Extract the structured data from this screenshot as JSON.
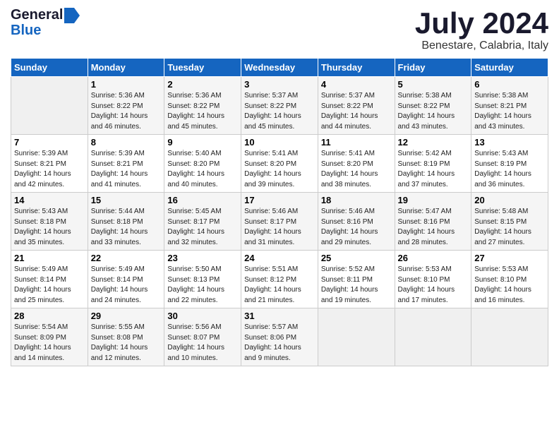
{
  "logo": {
    "line1": "General",
    "line2": "Blue"
  },
  "title": "July 2024",
  "location": "Benestare, Calabria, Italy",
  "weekdays": [
    "Sunday",
    "Monday",
    "Tuesday",
    "Wednesday",
    "Thursday",
    "Friday",
    "Saturday"
  ],
  "weeks": [
    [
      {
        "day": "",
        "info": ""
      },
      {
        "day": "1",
        "info": "Sunrise: 5:36 AM\nSunset: 8:22 PM\nDaylight: 14 hours\nand 46 minutes."
      },
      {
        "day": "2",
        "info": "Sunrise: 5:36 AM\nSunset: 8:22 PM\nDaylight: 14 hours\nand 45 minutes."
      },
      {
        "day": "3",
        "info": "Sunrise: 5:37 AM\nSunset: 8:22 PM\nDaylight: 14 hours\nand 45 minutes."
      },
      {
        "day": "4",
        "info": "Sunrise: 5:37 AM\nSunset: 8:22 PM\nDaylight: 14 hours\nand 44 minutes."
      },
      {
        "day": "5",
        "info": "Sunrise: 5:38 AM\nSunset: 8:22 PM\nDaylight: 14 hours\nand 43 minutes."
      },
      {
        "day": "6",
        "info": "Sunrise: 5:38 AM\nSunset: 8:21 PM\nDaylight: 14 hours\nand 43 minutes."
      }
    ],
    [
      {
        "day": "7",
        "info": "Sunrise: 5:39 AM\nSunset: 8:21 PM\nDaylight: 14 hours\nand 42 minutes."
      },
      {
        "day": "8",
        "info": "Sunrise: 5:39 AM\nSunset: 8:21 PM\nDaylight: 14 hours\nand 41 minutes."
      },
      {
        "day": "9",
        "info": "Sunrise: 5:40 AM\nSunset: 8:20 PM\nDaylight: 14 hours\nand 40 minutes."
      },
      {
        "day": "10",
        "info": "Sunrise: 5:41 AM\nSunset: 8:20 PM\nDaylight: 14 hours\nand 39 minutes."
      },
      {
        "day": "11",
        "info": "Sunrise: 5:41 AM\nSunset: 8:20 PM\nDaylight: 14 hours\nand 38 minutes."
      },
      {
        "day": "12",
        "info": "Sunrise: 5:42 AM\nSunset: 8:19 PM\nDaylight: 14 hours\nand 37 minutes."
      },
      {
        "day": "13",
        "info": "Sunrise: 5:43 AM\nSunset: 8:19 PM\nDaylight: 14 hours\nand 36 minutes."
      }
    ],
    [
      {
        "day": "14",
        "info": "Sunrise: 5:43 AM\nSunset: 8:18 PM\nDaylight: 14 hours\nand 35 minutes."
      },
      {
        "day": "15",
        "info": "Sunrise: 5:44 AM\nSunset: 8:18 PM\nDaylight: 14 hours\nand 33 minutes."
      },
      {
        "day": "16",
        "info": "Sunrise: 5:45 AM\nSunset: 8:17 PM\nDaylight: 14 hours\nand 32 minutes."
      },
      {
        "day": "17",
        "info": "Sunrise: 5:46 AM\nSunset: 8:17 PM\nDaylight: 14 hours\nand 31 minutes."
      },
      {
        "day": "18",
        "info": "Sunrise: 5:46 AM\nSunset: 8:16 PM\nDaylight: 14 hours\nand 29 minutes."
      },
      {
        "day": "19",
        "info": "Sunrise: 5:47 AM\nSunset: 8:16 PM\nDaylight: 14 hours\nand 28 minutes."
      },
      {
        "day": "20",
        "info": "Sunrise: 5:48 AM\nSunset: 8:15 PM\nDaylight: 14 hours\nand 27 minutes."
      }
    ],
    [
      {
        "day": "21",
        "info": "Sunrise: 5:49 AM\nSunset: 8:14 PM\nDaylight: 14 hours\nand 25 minutes."
      },
      {
        "day": "22",
        "info": "Sunrise: 5:49 AM\nSunset: 8:14 PM\nDaylight: 14 hours\nand 24 minutes."
      },
      {
        "day": "23",
        "info": "Sunrise: 5:50 AM\nSunset: 8:13 PM\nDaylight: 14 hours\nand 22 minutes."
      },
      {
        "day": "24",
        "info": "Sunrise: 5:51 AM\nSunset: 8:12 PM\nDaylight: 14 hours\nand 21 minutes."
      },
      {
        "day": "25",
        "info": "Sunrise: 5:52 AM\nSunset: 8:11 PM\nDaylight: 14 hours\nand 19 minutes."
      },
      {
        "day": "26",
        "info": "Sunrise: 5:53 AM\nSunset: 8:10 PM\nDaylight: 14 hours\nand 17 minutes."
      },
      {
        "day": "27",
        "info": "Sunrise: 5:53 AM\nSunset: 8:10 PM\nDaylight: 14 hours\nand 16 minutes."
      }
    ],
    [
      {
        "day": "28",
        "info": "Sunrise: 5:54 AM\nSunset: 8:09 PM\nDaylight: 14 hours\nand 14 minutes."
      },
      {
        "day": "29",
        "info": "Sunrise: 5:55 AM\nSunset: 8:08 PM\nDaylight: 14 hours\nand 12 minutes."
      },
      {
        "day": "30",
        "info": "Sunrise: 5:56 AM\nSunset: 8:07 PM\nDaylight: 14 hours\nand 10 minutes."
      },
      {
        "day": "31",
        "info": "Sunrise: 5:57 AM\nSunset: 8:06 PM\nDaylight: 14 hours\nand 9 minutes."
      },
      {
        "day": "",
        "info": ""
      },
      {
        "day": "",
        "info": ""
      },
      {
        "day": "",
        "info": ""
      }
    ]
  ]
}
